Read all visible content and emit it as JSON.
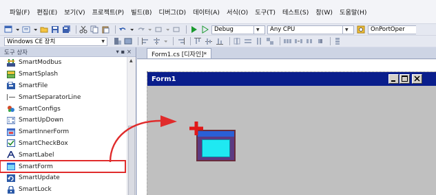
{
  "menubar": {
    "items": [
      "파일(F)",
      "편집(E)",
      "보기(V)",
      "프로젝트(P)",
      "빌드(B)",
      "디버그(D)",
      "데이터(A)",
      "서식(O)",
      "도구(T)",
      "테스트(S)",
      "창(W)",
      "도움말(H)"
    ]
  },
  "toolbar1": {
    "config_combo": "Debug",
    "platform_combo": "Any CPU",
    "find_combo": "OnPortOper"
  },
  "toolbar2": {
    "device_combo": "Windows CE 장치"
  },
  "toolbox": {
    "title": "도구 상자",
    "pin_glyph": "▾ ▪ ×",
    "items": [
      {
        "label": "SmartModbus",
        "icon": "modbus-icon"
      },
      {
        "label": "SmartSplash",
        "icon": "splash-icon"
      },
      {
        "label": "SmartFile",
        "icon": "file-icon"
      },
      {
        "label": "SmartSeparatorLine",
        "icon": "separator-line-icon"
      },
      {
        "label": "SmartConfigs",
        "icon": "configs-icon"
      },
      {
        "label": "SmartUpDown",
        "icon": "updown-icon"
      },
      {
        "label": "SmartInnerForm",
        "icon": "inner-form-icon"
      },
      {
        "label": "SmartCheckBox",
        "icon": "checkbox-icon"
      },
      {
        "label": "SmartLabel",
        "icon": "label-icon"
      },
      {
        "label": "SmartForm",
        "icon": "form-icon",
        "highlighted": true
      },
      {
        "label": "SmartUpdate",
        "icon": "update-icon"
      },
      {
        "label": "SmartLock",
        "icon": "lock-icon"
      }
    ]
  },
  "document": {
    "tab_label": "Form1.cs [디자인]*",
    "form_title": "Form1",
    "form_body_color": "#c0c0c0",
    "titlebar_color": "#0a1e8c"
  },
  "colors": {
    "highlight_red": "#e02b2b",
    "dropped_control_fill": "#1fe9f2"
  }
}
